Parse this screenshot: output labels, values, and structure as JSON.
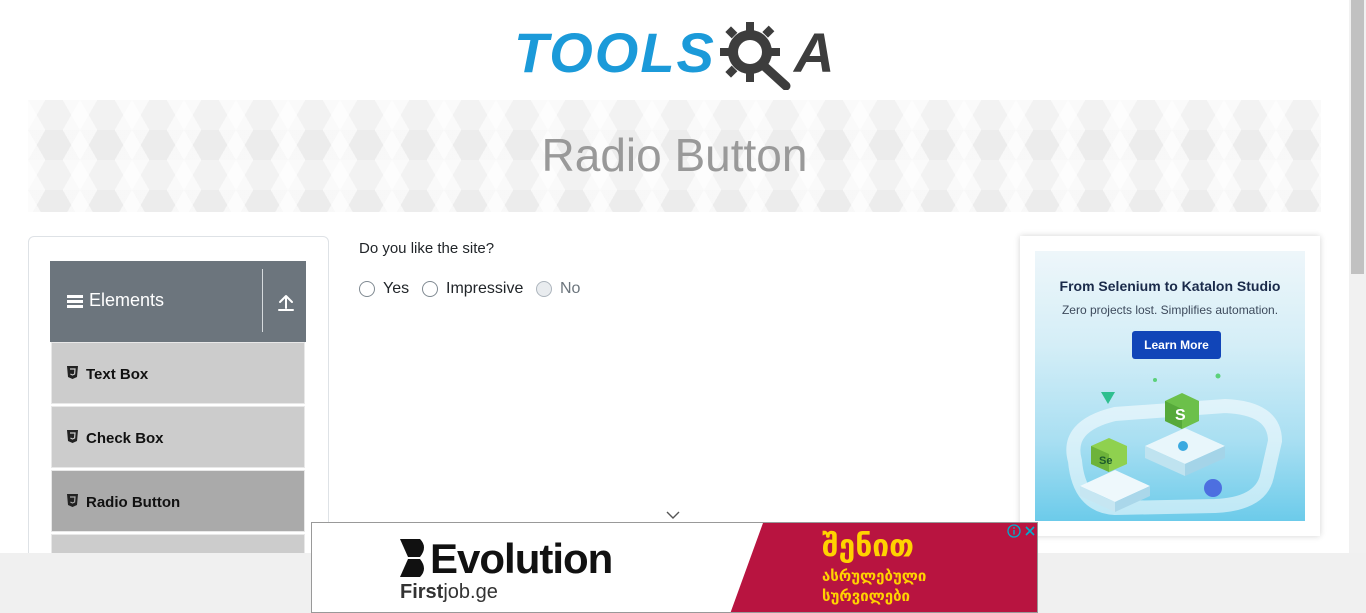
{
  "header": {
    "logo_text": "TOOLS",
    "logo_suffix": "A",
    "logo_alt": "TOOLSQA"
  },
  "banner": {
    "title": "Radio Button"
  },
  "sidebar": {
    "group_title": "Elements",
    "items": [
      {
        "label": "Text Box"
      },
      {
        "label": "Check Box"
      },
      {
        "label": "Radio Button",
        "active": true
      }
    ]
  },
  "form": {
    "question": "Do you like the site?",
    "options": [
      {
        "label": "Yes",
        "checked": false,
        "disabled": false
      },
      {
        "label": "Impressive",
        "checked": false,
        "disabled": false
      },
      {
        "label": "No",
        "checked": false,
        "disabled": true
      }
    ]
  },
  "ad_right": {
    "title": "From Selenium to Katalon Studio",
    "subtitle": "Zero projects lost. Simplifies automation.",
    "cta": "Learn More"
  },
  "ad_bottom": {
    "brand": "Evolution",
    "sub_bold": "First",
    "sub_rest": "job.ge",
    "headline": "შენით",
    "line1": "ასრულებული",
    "line2": "სურვილები"
  },
  "colors": {
    "logo_blue": "#1b9ad9",
    "sidebar_header": "#6c757d",
    "menu_item": "#cccccc",
    "menu_item_active": "#aaaaaa",
    "ad_red": "#b81440",
    "ad_yellow": "#ffd200",
    "cta_blue": "#1145b8"
  },
  "icons": [
    "gear-icon",
    "menu-icon",
    "upload-icon",
    "html5-icon",
    "chevron-down-icon",
    "info-icon",
    "close-icon"
  ]
}
